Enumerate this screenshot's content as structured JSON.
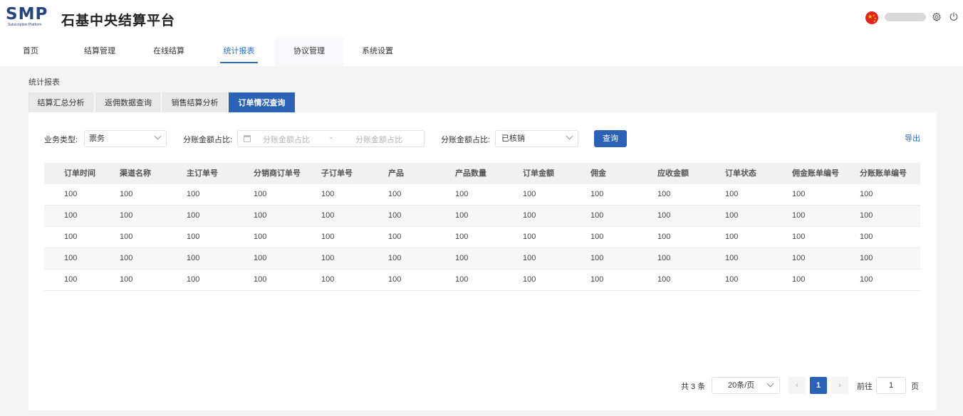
{
  "logo": {
    "text": "SMP",
    "subtext": "Subscription Platform"
  },
  "app_title": "石基中央结算平台",
  "header_icons": [
    "china-flag-icon",
    "gear-icon",
    "power-icon"
  ],
  "nav": [
    {
      "label": "首页"
    },
    {
      "label": "结算管理"
    },
    {
      "label": "在线结算"
    },
    {
      "label": "统计报表"
    },
    {
      "label": "协议管理"
    },
    {
      "label": "系统设置"
    }
  ],
  "breadcrumb": "统计报表",
  "tabs": [
    {
      "label": "结算汇总分析"
    },
    {
      "label": "返佣数据查询"
    },
    {
      "label": "销售结算分析"
    },
    {
      "label": "订单情况查询"
    }
  ],
  "filters": {
    "business_type_label": "业务类型:",
    "business_type_value": "票务",
    "split_ratio_label": "分账金额占比:",
    "split_ratio_start_placeholder": "分账金额占比",
    "range_separator": "-",
    "split_ratio_end_placeholder": "分账金额占比",
    "split_ratio2_label": "分账金额占比:",
    "split_ratio2_value": "已核销",
    "query_button": "查询",
    "export_link": "导出"
  },
  "table": {
    "columns": [
      "订单时间",
      "渠道名称",
      "主订单号",
      "分销商订单号",
      "子订单号",
      "产品",
      "产品数量",
      "订单金额",
      "佣金",
      "应收金额",
      "订单状态",
      "佣金账单编号",
      "分账账单编号"
    ],
    "rows": [
      [
        "100",
        "100",
        "100",
        "100",
        "100",
        "100",
        "100",
        "100",
        "100",
        "100",
        "100",
        "100",
        "100"
      ],
      [
        "100",
        "100",
        "100",
        "100",
        "100",
        "100",
        "100",
        "100",
        "100",
        "100",
        "100",
        "100",
        "100"
      ],
      [
        "100",
        "100",
        "100",
        "100",
        "100",
        "100",
        "100",
        "100",
        "100",
        "100",
        "100",
        "100",
        "100"
      ],
      [
        "100",
        "100",
        "100",
        "100",
        "100",
        "100",
        "100",
        "100",
        "100",
        "100",
        "100",
        "100",
        "100"
      ],
      [
        "100",
        "100",
        "100",
        "100",
        "100",
        "100",
        "100",
        "100",
        "100",
        "100",
        "100",
        "100",
        "100"
      ]
    ]
  },
  "pagination": {
    "total": "共 3 条",
    "page_size": "20条/页",
    "current_page": "1",
    "goto_label": "前往",
    "goto_value": "1",
    "page_suffix": "页",
    "prev_icon": "‹",
    "next_icon": "›"
  },
  "colors": {
    "primary": "#2c62b5",
    "link": "#2c6dc7",
    "background": "#f4f4f5"
  }
}
